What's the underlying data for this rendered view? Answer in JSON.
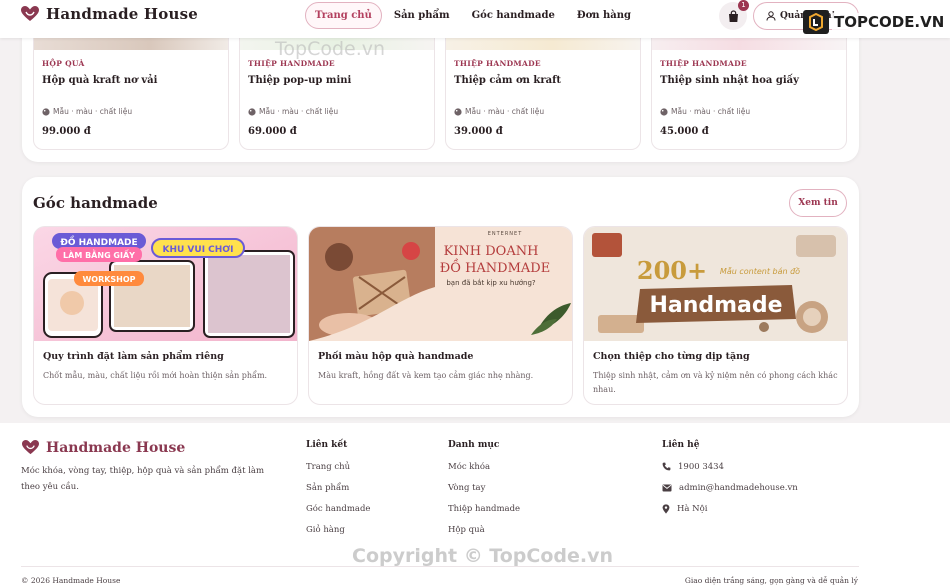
{
  "header": {
    "brand": "Handmade House",
    "nav": [
      "Trang chủ",
      "Sản phẩm",
      "Góc handmade",
      "Đơn hàng"
    ],
    "cart_count": "1",
    "account_label": "Quản lý tài"
  },
  "products": [
    {
      "category": "Hộp quà",
      "name": "Hộp quà kraft nơ vải",
      "attrs": "Mẫu · màu · chất liệu",
      "price": "99.000 đ"
    },
    {
      "category": "Thiệp handmade",
      "name": "Thiệp pop-up mini",
      "attrs": "Mẫu · màu · chất liệu",
      "price": "69.000 đ"
    },
    {
      "category": "Thiệp handmade",
      "name": "Thiệp cảm ơn kraft",
      "attrs": "Mẫu · màu · chất liệu",
      "price": "39.000 đ"
    },
    {
      "category": "Thiệp handmade",
      "name": "Thiệp sinh nhật hoa giấy",
      "attrs": "Mẫu · màu · chất liệu",
      "price": "45.000 đ"
    }
  ],
  "corner": {
    "title": "Góc handmade",
    "more_label": "Xem tin",
    "articles": [
      {
        "title": "Quy trình đặt làm sản phẩm riêng",
        "desc": "Chốt mẫu, màu, chất liệu rồi mới hoàn thiện sản phẩm.",
        "img_lines": [
          "ĐỒ HANDMADE",
          "LÀM BẰNG GIẤY",
          "KHU VUI CHƠI",
          "WORKSHOP"
        ]
      },
      {
        "title": "Phối màu hộp quà handmade",
        "desc": "Màu kraft, hồng đất và kem tạo cảm giác nhẹ nhàng.",
        "img_lines": [
          "KINH DOANH",
          "ĐỒ HANDMADE",
          "bạn đã bắt kịp xu hướng?",
          "ENTERNET"
        ]
      },
      {
        "title": "Chọn thiệp cho từng dịp tặng",
        "desc": "Thiệp sinh nhật, cảm ơn và kỷ niệm nên có phong cách khác nhau.",
        "img_lines": [
          "200+",
          "Mẫu content bán đồ",
          "Handmade"
        ]
      }
    ]
  },
  "footer": {
    "brand": "Handmade House",
    "desc": "Móc khóa, vòng tay, thiệp, hộp quà và sản phẩm đặt làm theo yêu cầu.",
    "links_title": "Liên kết",
    "links": [
      "Trang chủ",
      "Sản phẩm",
      "Góc handmade",
      "Giỏ hàng"
    ],
    "categories_title": "Danh mục",
    "categories": [
      "Móc khóa",
      "Vòng tay",
      "Thiệp handmade",
      "Hộp quà"
    ],
    "contact_title": "Liên hệ",
    "phone": "1900 3434",
    "email": "admin@handmadehouse.vn",
    "address": "Hà Nội",
    "copyright": "© 2026 Handmade House",
    "note": "Giao diện trắng sáng, gọn gàng và dễ quản lý"
  },
  "watermark": {
    "top": "TopCode.vn",
    "bottom": "Copyright © TopCode.vn",
    "logo": "TOPCODE.VN"
  },
  "colors": {
    "accent": "#9c3651",
    "accent_border": "#e2b2c0",
    "background": "#f4f1f2",
    "text": "#2a1f22"
  },
  "icons": {
    "brand": "heart-hands-icon",
    "cart": "shopping-bag-icon",
    "account": "user-icon",
    "dropdown": "chevron-down-icon",
    "attr": "palette-icon",
    "phone": "phone-icon",
    "email": "envelope-icon",
    "address": "map-pin-icon"
  }
}
